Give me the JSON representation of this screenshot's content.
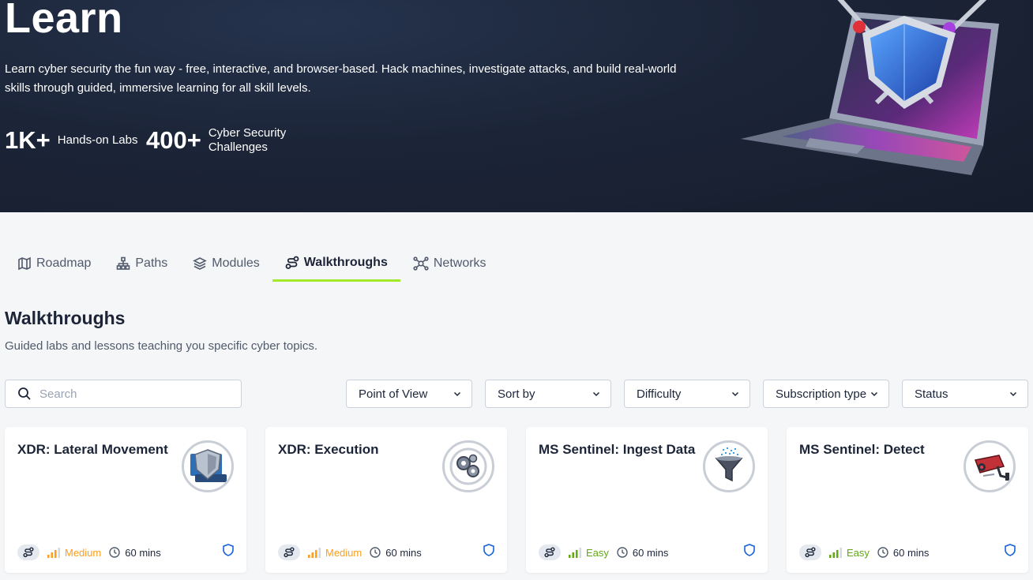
{
  "hero": {
    "title": "Learn",
    "description": "Learn cyber security the fun way - free, interactive, and browser-based. Hack machines, investigate attacks, and build real-world skills through guided, immersive learning for all skill levels.",
    "stats": [
      {
        "number": "1K+",
        "label": "Hands-on Labs"
      },
      {
        "number": "400+",
        "label": "Cyber Security Challenges"
      }
    ]
  },
  "tabs": [
    {
      "label": "Roadmap",
      "icon": "map-icon"
    },
    {
      "label": "Paths",
      "icon": "hierarchy-icon"
    },
    {
      "label": "Modules",
      "icon": "layers-icon"
    },
    {
      "label": "Walkthroughs",
      "icon": "route-icon",
      "active": true
    },
    {
      "label": "Networks",
      "icon": "network-icon"
    }
  ],
  "section": {
    "title": "Walkthroughs",
    "subtitle": "Guided labs and lessons teaching you specific cyber topics."
  },
  "search": {
    "placeholder": "Search",
    "value": ""
  },
  "filters": [
    {
      "label": "Point of View"
    },
    {
      "label": "Sort by"
    },
    {
      "label": "Difficulty"
    },
    {
      "label": "Subscription type"
    },
    {
      "label": "Status"
    }
  ],
  "cards": [
    {
      "title": "XDR: Lateral Movement",
      "difficulty": "Medium",
      "time": "60 mins",
      "thumb_icon": "shield-laptop-icon"
    },
    {
      "title": "XDR: Execution",
      "difficulty": "Medium",
      "time": "60 mins",
      "thumb_icon": "gears-icon"
    },
    {
      "title": "MS Sentinel: Ingest Data",
      "difficulty": "Easy",
      "time": "60 mins",
      "thumb_icon": "funnel-icon"
    },
    {
      "title": "MS Sentinel: Detect",
      "difficulty": "Easy",
      "time": "60 mins",
      "thumb_icon": "security-camera-icon"
    }
  ],
  "colors": {
    "hero_bg": "#1c2538",
    "tab_underline": "#a3ea2a",
    "medium": "#ff9e1b",
    "easy": "#61a916",
    "shield": "#1a63d6"
  }
}
